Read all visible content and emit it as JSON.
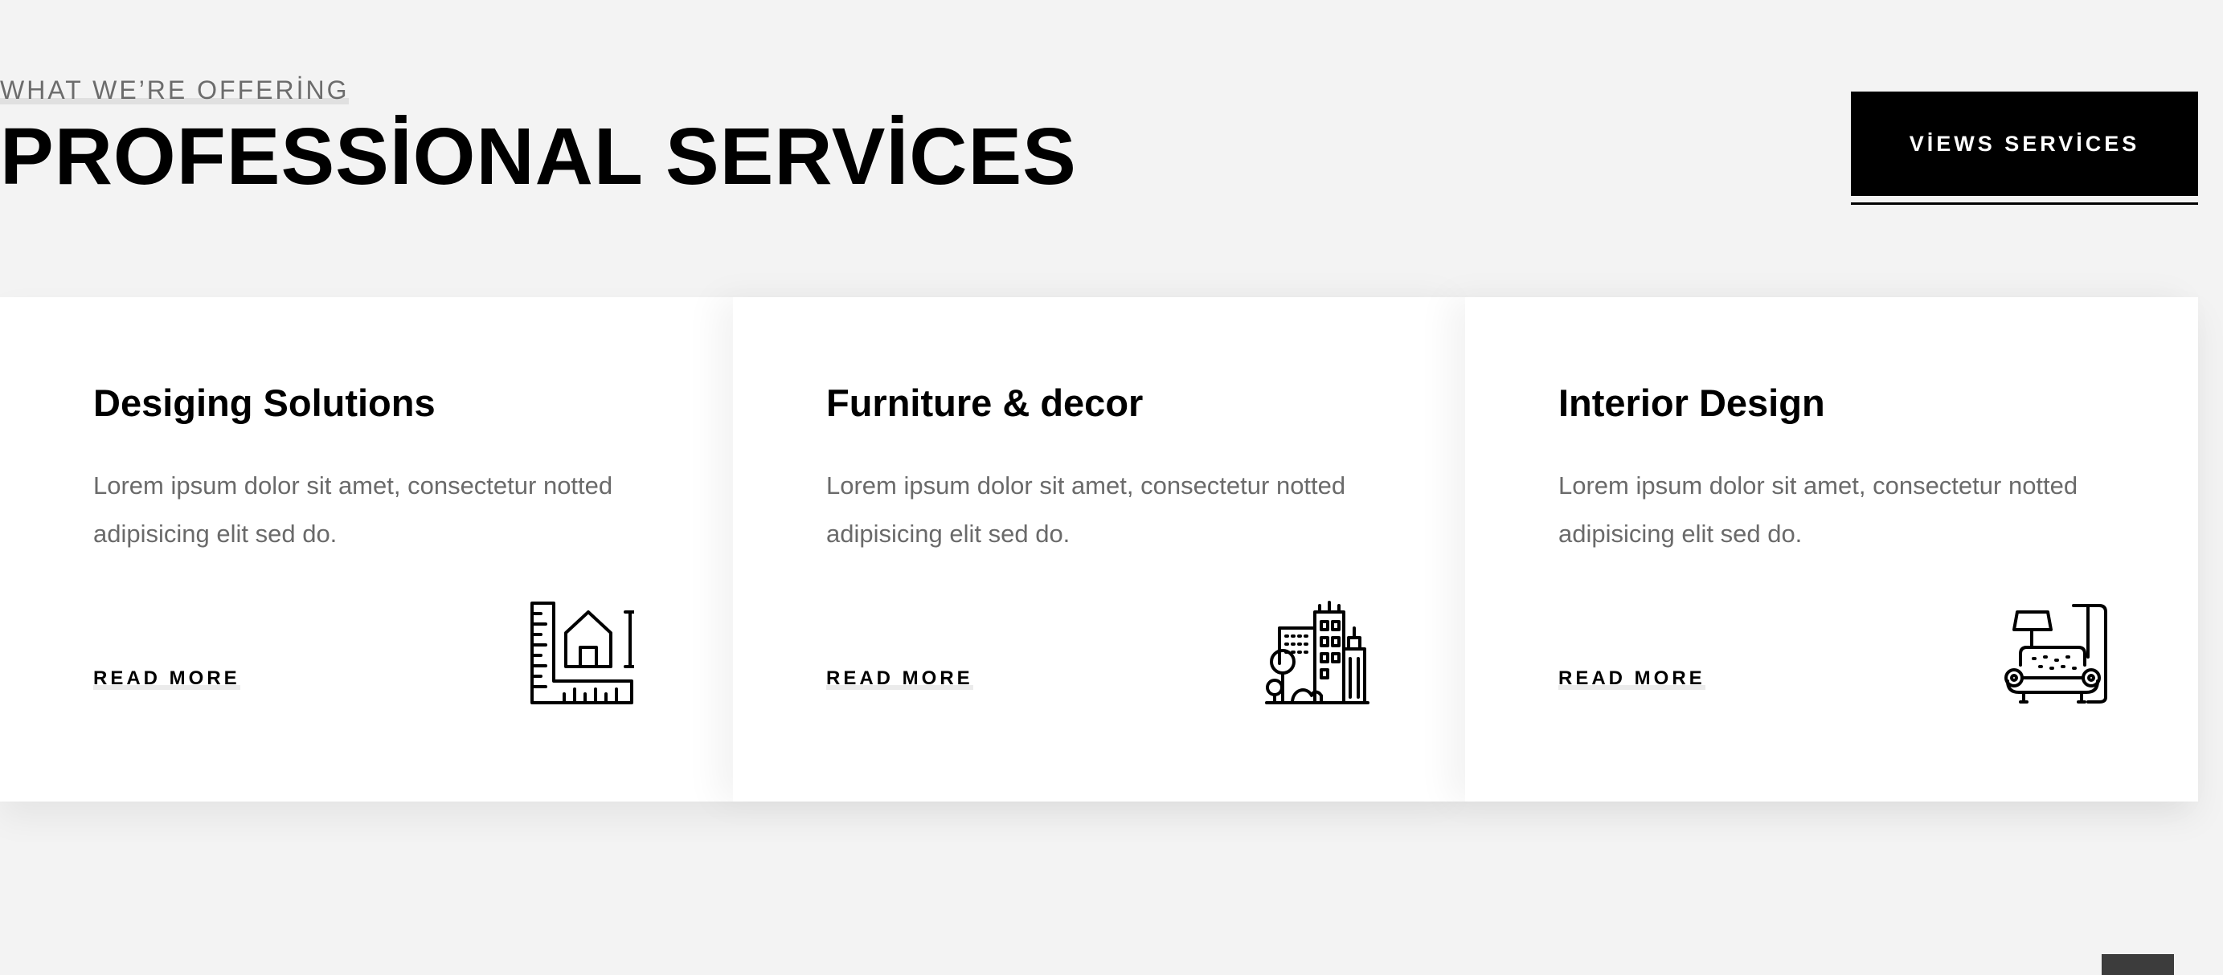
{
  "header": {
    "eyebrow": "WHAT WE’RE OFFERİNG",
    "title": "PROFESSİONAL SERVİCES",
    "cta_label": "VİEWS SERVİCES"
  },
  "cards": [
    {
      "title": "Desiging Solutions",
      "description": "Lorem ipsum dolor sit amet, consectetur notted adipisicing elit sed do.",
      "link": "READ MORE",
      "icon": "blueprint-house-icon"
    },
    {
      "title": "Furniture & decor",
      "description": "Lorem ipsum dolor sit amet, consectetur notted adipisicing elit sed do.",
      "link": "READ MORE",
      "icon": "city-buildings-icon"
    },
    {
      "title": "Interior Design",
      "description": "Lorem ipsum dolor sit amet, consectetur notted adipisicing elit sed do.",
      "link": "READ MORE",
      "icon": "armchair-lamp-icon"
    }
  ],
  "colors": {
    "background": "#f3f3f3",
    "card": "#ffffff",
    "accent": "#000000",
    "muted_text": "#6a6a6a"
  }
}
